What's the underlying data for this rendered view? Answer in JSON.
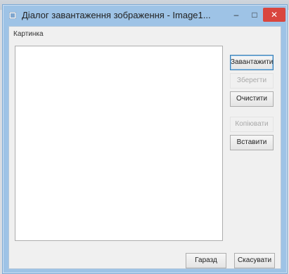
{
  "window": {
    "title": "Діалог завантаження зображення - Image1...",
    "minimize_glyph": "–",
    "maximize_glyph": "□",
    "close_glyph": "✕"
  },
  "group": {
    "label": "Картинка"
  },
  "buttons": {
    "load": "Завантажити",
    "export": "Зберегти",
    "clear": "Очистити",
    "copy": "Копіювати",
    "paste": "Вставити",
    "import": "Гаразд",
    "cancel": "Скасувати"
  },
  "colors": {
    "title_bar": "#9ec3e6",
    "close_button": "#d9463e",
    "dialog_background": "#f0f0f0"
  }
}
